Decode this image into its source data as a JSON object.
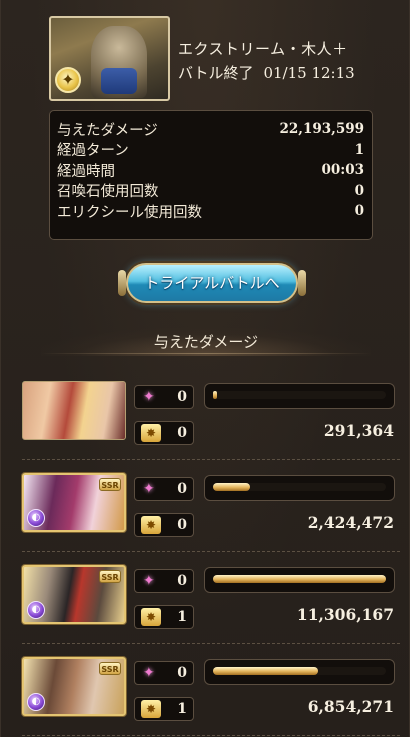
{
  "quest": {
    "title": "エクストリーム・木人＋",
    "sub_label": "バトル終了",
    "datetime": "01/15 12:13"
  },
  "stats": [
    {
      "label": "与えたダメージ",
      "value": "22,193,599"
    },
    {
      "label": "経過ターン",
      "value": "1"
    },
    {
      "label": "経過時間",
      "value": "00:03"
    },
    {
      "label": "召喚石使用回数",
      "value": "0"
    },
    {
      "label": "エリクシール使用回数",
      "value": "0"
    }
  ],
  "trial_button_label": "トライアルバトルへ",
  "section_title": "与えたダメージ",
  "characters": [
    {
      "skills": "0",
      "ca": "0",
      "damage": "291,364",
      "damage_ratio": 0.026,
      "ssr_label": "",
      "element": ""
    },
    {
      "skills": "0",
      "ca": "0",
      "damage": "2,424,472",
      "damage_ratio": 0.214,
      "ssr_label": "SSR",
      "element": "dark"
    },
    {
      "skills": "0",
      "ca": "1",
      "damage": "11,306,167",
      "damage_ratio": 1.0,
      "ssr_label": "SSR",
      "element": "dark"
    },
    {
      "skills": "0",
      "ca": "1",
      "damage": "6,854,271",
      "damage_ratio": 0.606,
      "ssr_label": "SSR",
      "element": "dark"
    }
  ],
  "icons": {
    "skill": "sparkle-icon",
    "charge_attack": "charge-attack-icon",
    "element_badge": "light-element-icon"
  },
  "colors": {
    "accent_button": "#53bfe0",
    "bar_fill": "#e3b45c",
    "panel_bg": "#120e0b"
  }
}
